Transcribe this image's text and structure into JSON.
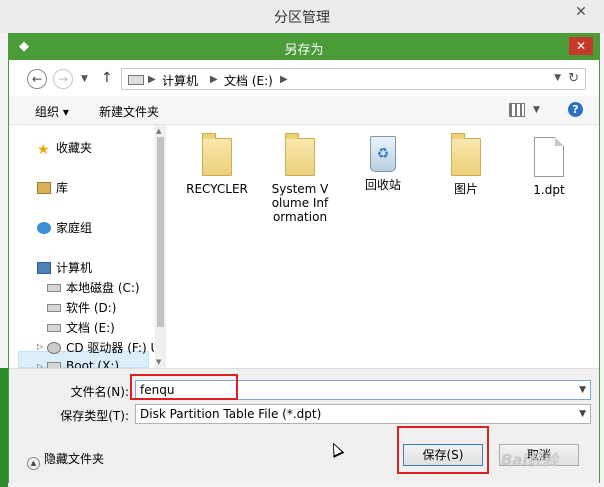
{
  "outer_window": {
    "title": "分区管理",
    "close_label": "✕"
  },
  "dialog": {
    "title": "另存为",
    "close_label": "✕"
  },
  "address_bar": {
    "path": [
      "计算机",
      "文档 (E:)"
    ]
  },
  "toolbar": {
    "organize": "组织 ▾",
    "new_folder": "新建文件夹",
    "help": "?"
  },
  "nav_pane": {
    "favorites": "收藏夹",
    "libraries": "库",
    "homegroup": "家庭组",
    "computer": "计算机",
    "drives": [
      "本地磁盘 (C:)",
      "软件 (D:)",
      "文档 (E:)",
      "CD 驱动器 (F:) U",
      "Boot (X:)"
    ]
  },
  "files": [
    {
      "name": "RECYCLER",
      "icon": "folder-icon"
    },
    {
      "name": "System Volume Information",
      "icon": "folder-icon"
    },
    {
      "name": "回收站",
      "icon": "recycle-bin-icon"
    },
    {
      "name": "图片",
      "icon": "folder-icon"
    },
    {
      "name": "1.dpt",
      "icon": "document-icon"
    }
  ],
  "form": {
    "filename_label": "文件名(N):",
    "filename_value": "fenqu",
    "filetype_label": "保存类型(T):",
    "filetype_value": "Disk Partition Table File (*.dpt)"
  },
  "buttons": {
    "save": "保存(S)",
    "cancel": "取消",
    "hide_folders": "隐藏文件夹"
  },
  "watermark": "Bai经验",
  "colors": {
    "title_bar": "#4a9c39",
    "close_button": "#c7392a",
    "highlight": "#e02020",
    "selection": "#ddeefb"
  }
}
